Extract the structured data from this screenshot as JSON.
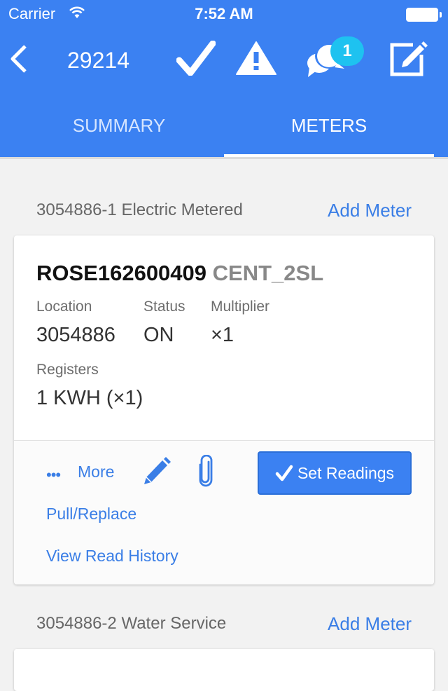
{
  "status_bar": {
    "carrier": "Carrier",
    "time": "7:52 AM"
  },
  "nav": {
    "title": "29214",
    "icons": [
      "back-chevron-icon",
      "checkmark-icon",
      "warning-icon",
      "chat-bubbles-icon",
      "edit-icon"
    ],
    "chat_badge_count": "1"
  },
  "tabs": [
    {
      "label": "SUMMARY",
      "active": false
    },
    {
      "label": "METERS",
      "active": true
    }
  ],
  "colors": {
    "header": "#3b81f2",
    "link": "#3a7ee6",
    "badge": "#1ec2f0",
    "background": "#f2f2f2"
  },
  "sections": [
    {
      "title": "3054886-1 Electric Metered",
      "add_label": "Add Meter",
      "meter": {
        "id": "ROSE162600409",
        "type": "CENT_2SL",
        "location_label": "Location",
        "location": "3054886",
        "status_label": "Status",
        "status": "ON",
        "multiplier_label": "Multiplier",
        "multiplier": "×1",
        "registers_label": "Registers",
        "registers": "1 KWH (×1)",
        "more_dots": "•••",
        "more_label": "More",
        "set_readings_label": "Set Readings",
        "pull_replace_label": "Pull/Replace",
        "view_history_label": "View Read History"
      }
    },
    {
      "title": "3054886-2 Water Service",
      "add_label": "Add Meter"
    }
  ]
}
